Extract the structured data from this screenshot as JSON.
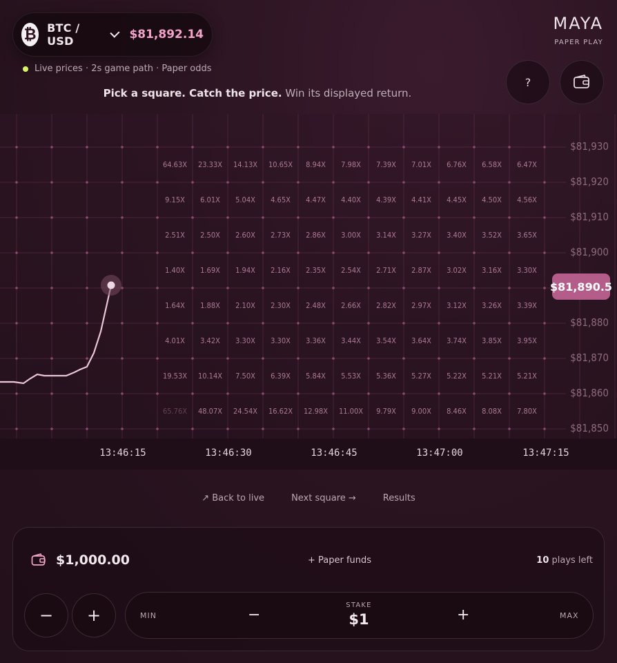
{
  "header": {
    "asset_icon": "bitcoin-icon",
    "pair": "BTC / USD",
    "price": "$81,892.14",
    "status_text": "Live prices · 2s game path · Paper odds",
    "brand": "MAYA",
    "brand_sub": "PAPER PLAY",
    "help_label": "?",
    "wallet_icon": "wallet-icon"
  },
  "instruction": {
    "bold": "Pick a square. Catch the price.",
    "rest": " Win its displayed return."
  },
  "chart": {
    "price_labels": [
      "$81,930",
      "$81,920",
      "$81,910",
      "$81,900",
      "$81,880",
      "$81,870",
      "$81,860",
      "$81,850"
    ],
    "current_price_tag": "$81,890.5",
    "time_labels": [
      "13:46:15",
      "13:46:30",
      "13:46:45",
      "13:47:00",
      "13:47:15"
    ],
    "multipliers": [
      [
        "64.63X",
        "23.33X",
        "14.13X",
        "10.65X",
        "8.94X",
        "7.98X",
        "7.39X",
        "7.01X",
        "6.76X",
        "6.58X",
        "6.47X"
      ],
      [
        "9.15X",
        "6.01X",
        "5.04X",
        "4.65X",
        "4.47X",
        "4.40X",
        "4.39X",
        "4.41X",
        "4.45X",
        "4.50X",
        "4.56X"
      ],
      [
        "2.51X",
        "2.50X",
        "2.60X",
        "2.73X",
        "2.86X",
        "3.00X",
        "3.14X",
        "3.27X",
        "3.40X",
        "3.52X",
        "3.65X"
      ],
      [
        "1.40X",
        "1.69X",
        "1.94X",
        "2.16X",
        "2.35X",
        "2.54X",
        "2.71X",
        "2.87X",
        "3.02X",
        "3.16X",
        "3.30X"
      ],
      [
        "1.64X",
        "1.88X",
        "2.10X",
        "2.30X",
        "2.48X",
        "2.66X",
        "2.82X",
        "2.97X",
        "3.12X",
        "3.26X",
        "3.39X"
      ],
      [
        "4.01X",
        "3.42X",
        "3.30X",
        "3.30X",
        "3.36X",
        "3.44X",
        "3.54X",
        "3.64X",
        "3.74X",
        "3.85X",
        "3.95X"
      ],
      [
        "19.53X",
        "10.14X",
        "7.50X",
        "6.39X",
        "5.84X",
        "5.53X",
        "5.36X",
        "5.27X",
        "5.22X",
        "5.21X",
        "5.21X"
      ],
      [
        "65.76X",
        "48.07X",
        "24.54X",
        "16.62X",
        "12.98X",
        "11.00X",
        "9.79X",
        "9.00X",
        "8.46X",
        "8.08X",
        "7.80X"
      ]
    ]
  },
  "links": {
    "back": "↗ Back to live",
    "next": "Next square →",
    "results": "Results"
  },
  "panel": {
    "wallet_icon": "wallet-icon",
    "balance": "$1,000.00",
    "paper_funds": "+ Paper funds",
    "plays_count": "10",
    "plays_text": " plays left",
    "minus": "−",
    "plus": "+",
    "min_label": "MIN",
    "max_label": "MAX",
    "stake_label": "STAKE",
    "stake_value": "$1"
  },
  "colors": {
    "accent_pink": "#f3a3c9",
    "price_tag": "#b45d8a",
    "live_dot": "#d9f36a"
  }
}
